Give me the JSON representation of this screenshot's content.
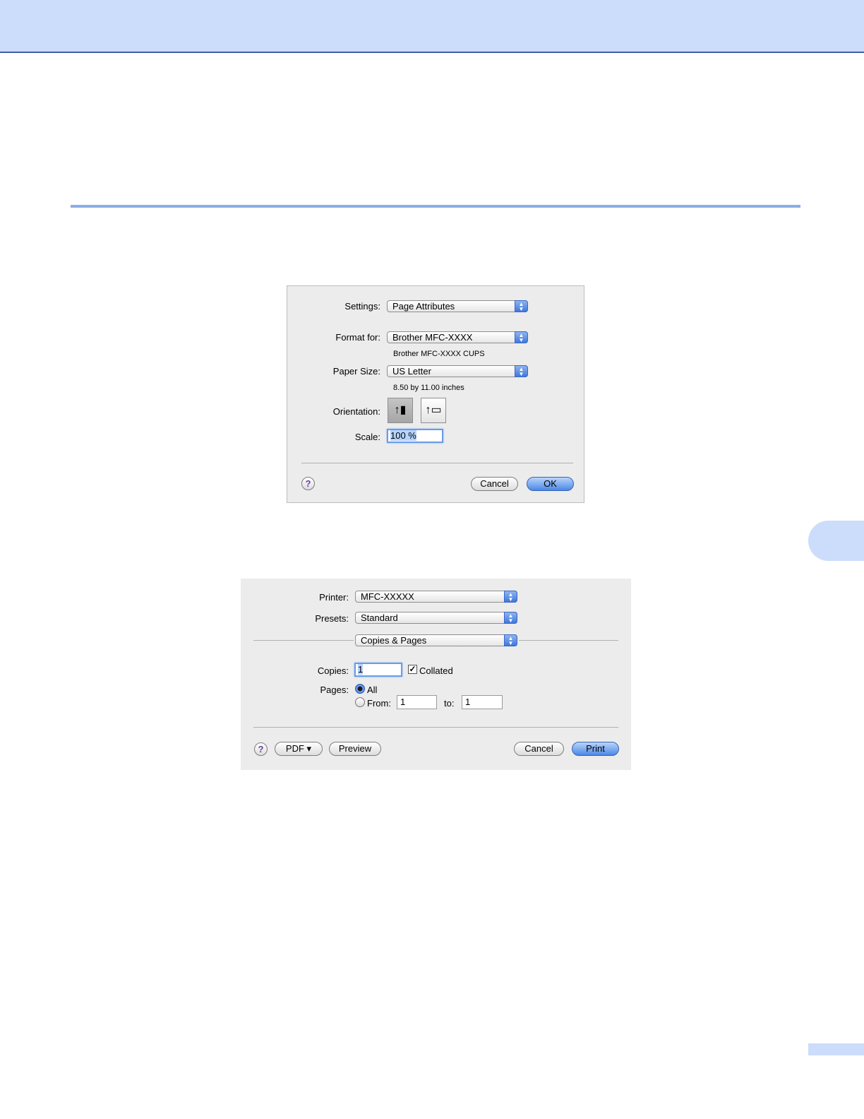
{
  "page_setup": {
    "settings": {
      "label": "Settings:",
      "value": "Page Attributes"
    },
    "format_for": {
      "label": "Format for:",
      "value": "Brother MFC-XXXX",
      "note": "Brother MFC-XXXX CUPS"
    },
    "paper_size": {
      "label": "Paper Size:",
      "value": "US Letter",
      "note": "8.50 by 11.00 inches"
    },
    "orientation": {
      "label": "Orientation:",
      "selected": "portrait"
    },
    "scale": {
      "label": "Scale:",
      "value": "100 %"
    },
    "help": "?",
    "cancel": "Cancel",
    "ok": "OK"
  },
  "print": {
    "printer": {
      "label": "Printer:",
      "value": "MFC-XXXXX"
    },
    "presets": {
      "label": "Presets:",
      "value": "Standard"
    },
    "panel": {
      "value": "Copies & Pages"
    },
    "copies": {
      "label": "Copies:",
      "value": "1",
      "collated_label": "Collated",
      "collated": true
    },
    "pages": {
      "label": "Pages:",
      "all_label": "All",
      "from_label": "From:",
      "from_value": "1",
      "to_label": "to:",
      "to_value": "1",
      "selected": "all"
    },
    "help": "?",
    "pdf": "PDF ▾",
    "preview": "Preview",
    "cancel": "Cancel",
    "print_btn": "Print"
  }
}
